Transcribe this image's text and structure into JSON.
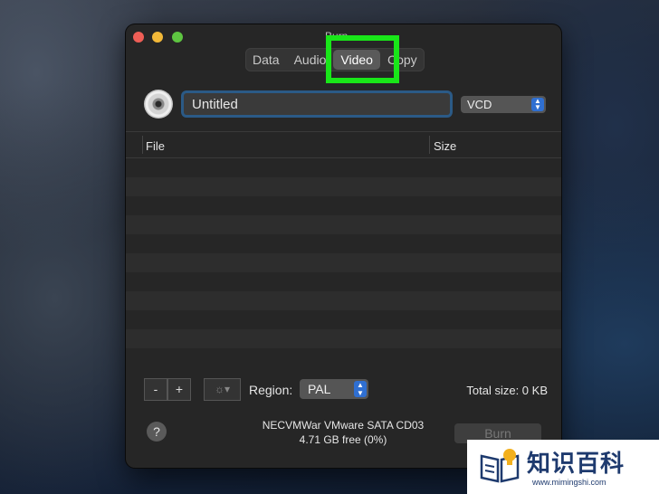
{
  "window": {
    "title": "Burn",
    "tabs": [
      {
        "label": "Data",
        "selected": false
      },
      {
        "label": "Audio",
        "selected": false
      },
      {
        "label": "Video",
        "selected": true
      },
      {
        "label": "Copy",
        "selected": false
      }
    ]
  },
  "disc": {
    "icon": "disc-icon",
    "title_value": "Untitled",
    "format": "VCD"
  },
  "file_list": {
    "columns": [
      "File",
      "Size"
    ],
    "rows": []
  },
  "controls": {
    "remove_label": "-",
    "add_label": "+",
    "action_label": "☼▾",
    "region_label": "Region:",
    "region_value": "PAL",
    "total_size": "Total size: 0 KB"
  },
  "footer": {
    "help_label": "?",
    "device_name": "NECVMWar VMware SATA CD03",
    "device_free": "4.71 GB free (0%)",
    "burn_label": "Burn"
  },
  "watermark": {
    "title": "知识百科",
    "url": "www.mimingshi.com"
  },
  "colors": {
    "highlight": "#19e619",
    "window_bg": "#262626",
    "accent": "#2f6fd1"
  }
}
